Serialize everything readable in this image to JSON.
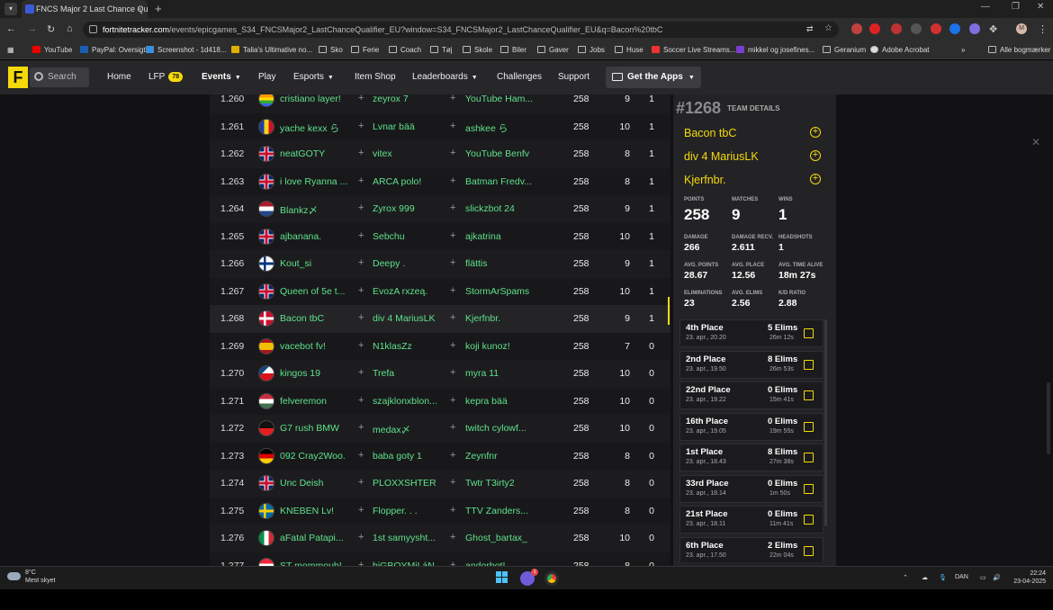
{
  "browser": {
    "tab_title": "FNCS Major 2 Last Chance Qu",
    "tab_close": "×",
    "new_tab": "+",
    "url_domain": "fortnitetracker.com",
    "url_path": "/events/epicgames_S34_FNCSMajor2_LastChanceQualifier_EU?window=S34_FNCSMajor2_LastChanceQualifier_EU&q=Bacon%20tbC",
    "bookmarks": [
      "YouTube",
      "PayPal: Oversigt",
      "Screenshot - 1d418...",
      "Talia's Ultimative no...",
      "Sko",
      "Ferie",
      "Coach",
      "Tøj",
      "Skole",
      "Biler",
      "Gaver",
      "Jobs",
      "Huse",
      "Soccer Live Streams...",
      "mikkel og josefines...",
      "Geranium",
      "Adobe Acrobat"
    ],
    "all_bookmarks": "Alle bogmærker",
    "more": "»",
    "profile_letter": "M"
  },
  "site_nav": {
    "logo": "F",
    "search_placeholder": "Search",
    "items": [
      "Home",
      "LFP",
      "Events",
      "Play",
      "Esports",
      "Item Shop",
      "Leaderboards",
      "Challenges",
      "Support"
    ],
    "lfp_badge": "78",
    "get_apps": "Get the Apps"
  },
  "leaderboard": {
    "rows": [
      {
        "rank": "1.260",
        "p1": "cristiano layer!",
        "p2": "zeyrox 7",
        "p3": "YouTube Ham...",
        "points": "258",
        "matches": "9",
        "wins": "1",
        "flag": "rainbow"
      },
      {
        "rank": "1.261",
        "p1": "yache kexx ら",
        "p2": "Lvnar bää",
        "p3": "ashkee ら",
        "points": "258",
        "matches": "10",
        "wins": "1",
        "flag": "ro"
      },
      {
        "rank": "1.262",
        "p1": "neatGOTY",
        "p2": "vitex",
        "p3": "YouTube Benfv",
        "points": "258",
        "matches": "8",
        "wins": "1",
        "flag": "uk"
      },
      {
        "rank": "1.263",
        "p1": "i love Ryanna ...",
        "p2": "ARCA polo!",
        "p3": "Batman Fredv...",
        "points": "258",
        "matches": "8",
        "wins": "1",
        "flag": "uk"
      },
      {
        "rank": "1.264",
        "p1": "Blankz〆",
        "p2": "Zyrox 999",
        "p3": "slickzbot 24",
        "points": "258",
        "matches": "9",
        "wins": "1",
        "flag": "nl"
      },
      {
        "rank": "1.265",
        "p1": "ajbanana.",
        "p2": "Sebchu",
        "p3": "ajkatrina",
        "points": "258",
        "matches": "10",
        "wins": "1",
        "flag": "uk"
      },
      {
        "rank": "1.266",
        "p1": "Kout_si",
        "p2": "Deepy .",
        "p3": "flättis",
        "points": "258",
        "matches": "9",
        "wins": "1",
        "flag": "fi"
      },
      {
        "rank": "1.267",
        "p1": "Queen of 5e t...",
        "p2": "EvozA rxzeą.",
        "p3": "StormArSpams",
        "points": "258",
        "matches": "10",
        "wins": "1",
        "flag": "uk"
      },
      {
        "rank": "1.268",
        "p1": "Bacon tbC",
        "p2": "div 4 MariusLK",
        "p3": "Kjerfnbr.",
        "points": "258",
        "matches": "9",
        "wins": "1",
        "flag": "dk",
        "selected": true
      },
      {
        "rank": "1.269",
        "p1": "vacebot fv!",
        "p2": "N1klasZz",
        "p3": "koji kunoz!",
        "points": "258",
        "matches": "7",
        "wins": "0",
        "flag": "es"
      },
      {
        "rank": "1.270",
        "p1": "kingos 19",
        "p2": "Trefa",
        "p3": "myra 11",
        "points": "258",
        "matches": "10",
        "wins": "0",
        "flag": "cz"
      },
      {
        "rank": "1.271",
        "p1": "felveremon",
        "p2": "szajklonxblon...",
        "p3": "kepra bää",
        "points": "258",
        "matches": "10",
        "wins": "0",
        "flag": "hu"
      },
      {
        "rank": "1.272",
        "p1": "G7 rush BMW",
        "p2": "medax〆",
        "p3": "twitch cylowf...",
        "points": "258",
        "matches": "10",
        "wins": "0",
        "flag": "al"
      },
      {
        "rank": "1.273",
        "p1": "092 Cray2Woo.",
        "p2": "baba goty 1",
        "p3": "Zeynfnr",
        "points": "258",
        "matches": "8",
        "wins": "0",
        "flag": "de"
      },
      {
        "rank": "1.274",
        "p1": "Unc Deish",
        "p2": "PLOXXSHTER",
        "p3": "Twtr T3irty2",
        "points": "258",
        "matches": "8",
        "wins": "0",
        "flag": "uk"
      },
      {
        "rank": "1.275",
        "p1": "KNEBEN Lv!",
        "p2": "Flopper. . .",
        "p3": "TTV Zanders...",
        "points": "258",
        "matches": "8",
        "wins": "0",
        "flag": "se"
      },
      {
        "rank": "1.276",
        "p1": "aFatal Patapi...",
        "p2": "1st samyysht...",
        "p3": "Ghost_bartax_",
        "points": "258",
        "matches": "10",
        "wins": "0",
        "flag": "it"
      },
      {
        "rank": "1.277",
        "p1": "ST mommouh!",
        "p2": "biGBOYMiLáN",
        "p3": "andorbot!",
        "points": "258",
        "matches": "8",
        "wins": "0",
        "flag": "at"
      }
    ]
  },
  "team": {
    "number": "#1268",
    "label": "TEAM DETAILS",
    "members": [
      "Bacon tbC",
      "div 4 MariusLK",
      "Kjerfnbr."
    ],
    "add_icon": "+",
    "stats_big": [
      {
        "label": "POINTS",
        "value": "258"
      },
      {
        "label": "MATCHES",
        "value": "9"
      },
      {
        "label": "WINS",
        "value": "1"
      }
    ],
    "stats_small": [
      {
        "label": "DAMAGE",
        "value": "266"
      },
      {
        "label": "DAMAGE RECV.",
        "value": "2.611"
      },
      {
        "label": "HEADSHOTS",
        "value": "1"
      },
      {
        "label": "AVG. POINTS",
        "value": "28.67"
      },
      {
        "label": "AVG. PLACE",
        "value": "12.56"
      },
      {
        "label": "AVG. TIME ALIVE",
        "value": "18m 27s"
      },
      {
        "label": "ELIMINATIONS",
        "value": "23"
      },
      {
        "label": "AVG. ELIMS",
        "value": "2.56"
      },
      {
        "label": "K/D RATIO",
        "value": "2.88"
      }
    ],
    "matches": [
      {
        "place": "4th Place",
        "date": "23. apr., 20.20",
        "elims": "5 Elims",
        "time": "26m 12s"
      },
      {
        "place": "2nd Place",
        "date": "23. apr., 19.50",
        "elims": "8 Elims",
        "time": "26m 53s"
      },
      {
        "place": "22nd Place",
        "date": "23. apr., 19.22",
        "elims": "0 Elims",
        "time": "15m 41s"
      },
      {
        "place": "16th Place",
        "date": "23. apr., 19.05",
        "elims": "0 Elims",
        "time": "19m 55s"
      },
      {
        "place": "1st Place",
        "date": "23. apr., 18.43",
        "elims": "8 Elims",
        "time": "27m 38s"
      },
      {
        "place": "33rd Place",
        "date": "23. apr., 18.14",
        "elims": "0 Elims",
        "time": "1m 50s"
      },
      {
        "place": "21st Place",
        "date": "23. apr., 18.11",
        "elims": "0 Elims",
        "time": "11m 41s"
      },
      {
        "place": "6th Place",
        "date": "23. apr., 17.50",
        "elims": "2 Elims",
        "time": "22m 04s"
      }
    ]
  },
  "taskbar": {
    "temp": "8°C",
    "weather": "Mest skyet",
    "lang": "DAN",
    "time": "22:24",
    "date": "23-04-2025",
    "chat_badge": "1"
  },
  "colors": {
    "accent": "#f5d90a",
    "player": "#5fe28a"
  }
}
